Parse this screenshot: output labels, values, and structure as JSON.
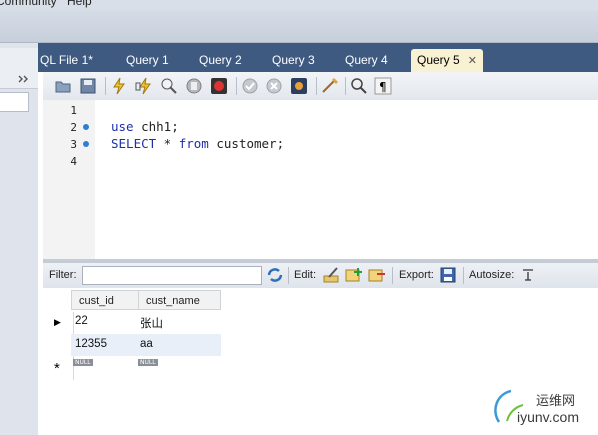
{
  "menubar": {
    "items": [
      "Community",
      "Help"
    ]
  },
  "tabs": [
    "QL File 1*",
    "Query 1",
    "Query 2",
    "Query 3",
    "Query 4",
    "Query 5"
  ],
  "active_tab_close": "✕",
  "editor": {
    "line_numbers": [
      "1",
      "2",
      "3",
      "4"
    ],
    "line2": {
      "kw": "use",
      "rest": " chh1;"
    },
    "line3": {
      "kw1": "SELECT",
      "mid": " * ",
      "kw2": "from",
      "rest": " customer;"
    }
  },
  "results_toolbar": {
    "filter_label": "Filter:",
    "edit_label": "Edit:",
    "export_label": "Export:",
    "autosize_label": "Autosize:"
  },
  "grid": {
    "columns": [
      "cust_id",
      "cust_name"
    ],
    "rows": [
      {
        "cust_id": "22",
        "cust_name": "张山"
      },
      {
        "cust_id": "12355",
        "cust_name": "aa"
      }
    ],
    "null_label": "NULL",
    "new_row_marker": "*",
    "current_row_marker": "▶"
  },
  "watermark": {
    "cn": "运维网",
    "url": "iyunv.com"
  },
  "colors": {
    "tabbar": "#3f5a80",
    "active_tab": "#f8f1d2",
    "keyword": "#1d2fa8",
    "marker_dot": "#2f7fd1"
  }
}
